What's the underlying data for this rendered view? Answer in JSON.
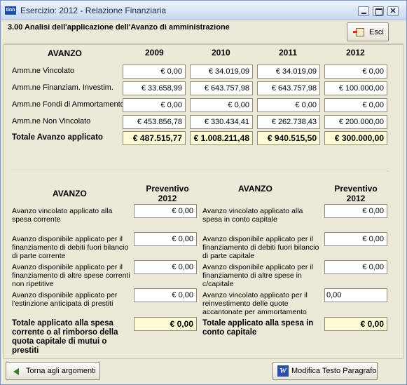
{
  "window": {
    "app_icon": "tinn",
    "title": "Esercizio: 2012 - Relazione Finanziaria",
    "controls": {
      "minimize": "",
      "maximize": "",
      "close": "✕"
    }
  },
  "header": {
    "section_title": "3.00 Analisi dell'applicazione dell'Avanzo di amministrazione",
    "esci_label": "Esci"
  },
  "top_table": {
    "heading": "AVANZO",
    "years": [
      "2009",
      "2010",
      "2011",
      "2012"
    ],
    "rows": [
      {
        "label": "Amm.ne Vincolato",
        "values": [
          "€ 0,00",
          "€ 34.019,09",
          "€ 34.019,09",
          "€ 0,00"
        ]
      },
      {
        "label": "Amm.ne Finanziam. Investim.",
        "values": [
          "€ 33.658,99",
          "€ 643.757,98",
          "€ 643.757,98",
          "€ 100.000,00"
        ]
      },
      {
        "label": "Amm.ne Fondi di Ammortamento",
        "values": [
          "€ 0,00",
          "€ 0,00",
          "€ 0,00",
          "€ 0,00"
        ]
      },
      {
        "label": "Amm.ne Non Vincolato",
        "values": [
          "€ 453.856,78",
          "€ 330.434,41",
          "€ 262.738,43",
          "€ 200.000,00"
        ]
      }
    ],
    "total": {
      "label": "Totale Avanzo applicato",
      "values": [
        "€ 487.515,77",
        "€ 1.008.211,48",
        "€ 940.515,50",
        "€ 300.000,00"
      ]
    }
  },
  "bottom": {
    "left": {
      "heading": "AVANZO",
      "col_heading_line1": "Preventivo",
      "col_heading_line2": "2012",
      "items": [
        {
          "label": [
            "Avanzo vincolato applicato alla",
            "spesa corrente"
          ],
          "value": "€ 0,00"
        },
        {
          "label": [
            "Avanzo disponibile applicato per il",
            "finanziamento di debiti fuori bilancio",
            "di parte corrente"
          ],
          "value": "€ 0,00"
        },
        {
          "label": [
            "Avanzo disponibile applicato per il",
            "finanziamento di altre spese correnti",
            "non ripetitive"
          ],
          "value": "€ 0,00"
        },
        {
          "label": [
            "Avanzo disponibile applicato per",
            "l'estinzione anticipata di prestiti"
          ],
          "value": "€ 0,00"
        }
      ],
      "total_label": [
        "Totale applicato alla spesa",
        "corrente o al rimborso della",
        "quota capitale di mutui o",
        "prestiti"
      ],
      "total_value": "€ 0,00"
    },
    "right": {
      "heading": "AVANZO",
      "col_heading_line1": "Preventivo",
      "col_heading_line2": "2012",
      "items": [
        {
          "label": [
            "Avanzo vincolato applicato alla",
            "spesa in conto capitale"
          ],
          "value": "€ 0,00"
        },
        {
          "label": [
            "Avanzo disponibile applicato per il",
            "finanziamento di debiti fuori bilancio",
            "di parte capitale"
          ],
          "value": "€ 0,00"
        },
        {
          "label": [
            "Avanzo disponibile applicato per il",
            "finanziamento di altre spese in",
            "c/capitale"
          ],
          "value": "€ 0,00"
        },
        {
          "label": [
            "Avanzo vincolato applicato per il",
            "reinvestimento delle quote",
            "accantonate per ammortamento"
          ],
          "value": "0,00"
        }
      ],
      "total_label": [
        "Totale applicato alla spesa in",
        "conto capitale"
      ],
      "total_value": "€ 0,00"
    }
  },
  "footer": {
    "torna_label": "Torna agli argomenti",
    "modifica_icon": "W",
    "modifica_label": "Modifica Testo Paragrafo"
  }
}
